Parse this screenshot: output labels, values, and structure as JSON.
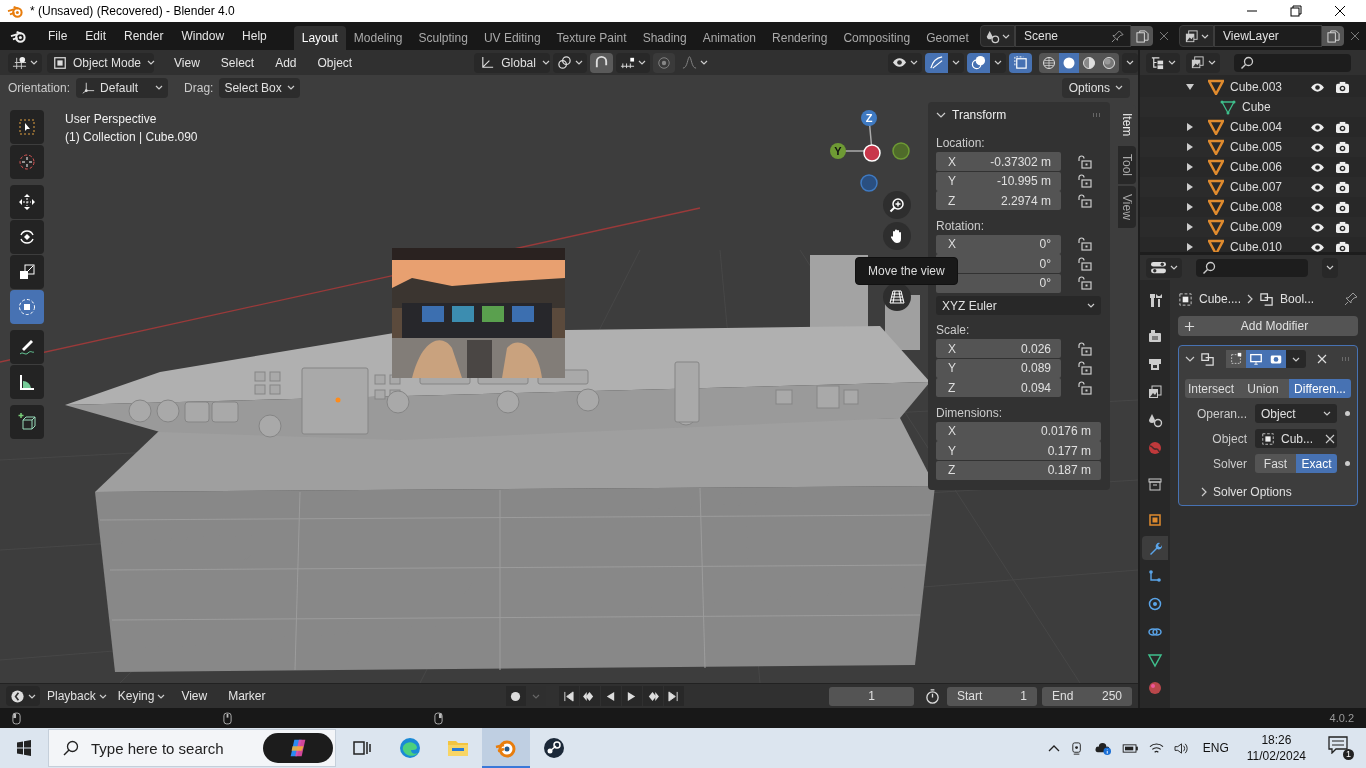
{
  "window": {
    "title": "* (Unsaved) (Recovered) - Blender 4.0"
  },
  "menu_bar": [
    "File",
    "Edit",
    "Render",
    "Window",
    "Help"
  ],
  "workspaces": [
    {
      "label": "Layout",
      "selected": true
    },
    {
      "label": "Modeling",
      "selected": false
    },
    {
      "label": "Sculpting",
      "selected": false
    },
    {
      "label": "UV Editing",
      "selected": false
    },
    {
      "label": "Texture Paint",
      "selected": false
    },
    {
      "label": "Shading",
      "selected": false
    },
    {
      "label": "Animation",
      "selected": false
    },
    {
      "label": "Rendering",
      "selected": false
    },
    {
      "label": "Compositing",
      "selected": false
    },
    {
      "label": "Geomet",
      "selected": false
    }
  ],
  "scene": {
    "name": "Scene"
  },
  "view_layer": {
    "name": "ViewLayer"
  },
  "header": {
    "mode": "Object Mode",
    "menus": [
      "View",
      "Select",
      "Add",
      "Object"
    ],
    "orientation": "Global",
    "snap": true,
    "proportional": false,
    "show_gizmo": true,
    "show_overlays": true,
    "xray": true,
    "shading": [
      {
        "kind": "wireframe",
        "selected": false
      },
      {
        "kind": "solid",
        "selected": true
      },
      {
        "kind": "material",
        "selected": false
      },
      {
        "kind": "rendered",
        "selected": false
      }
    ]
  },
  "tool_settings": {
    "orientation_label": "Orientation:",
    "orientation": "Default",
    "drag_label": "Drag:",
    "drag": "Select Box",
    "options": "Options"
  },
  "viewport": {
    "title": "User Perspective",
    "info": "(1) Collection | Cube.090",
    "gizmo_labels": [
      "Z",
      "Y"
    ],
    "tooltip": "Move the view",
    "tools": [
      {
        "kind": "select",
        "selected": false
      },
      {
        "kind": "cursor",
        "selected": false
      },
      {
        "kind": "move",
        "selected": false
      },
      {
        "kind": "rotate",
        "selected": false
      },
      {
        "kind": "scale",
        "selected": false
      },
      {
        "kind": "transform",
        "selected": true
      },
      {
        "kind": "annotate",
        "selected": false
      },
      {
        "kind": "measure",
        "selected": false
      },
      {
        "kind": "add_cube",
        "selected": false
      }
    ]
  },
  "sidebar": {
    "tabs": [
      {
        "label": "Item",
        "selected": true
      },
      {
        "label": "Tool",
        "selected": false
      },
      {
        "label": "View",
        "selected": false
      }
    ],
    "panel_title": "Transform",
    "groups": [
      {
        "label": "Location:",
        "kind": "lockable",
        "fields": [
          {
            "axis": "X",
            "value": "-0.37302 m"
          },
          {
            "axis": "Y",
            "value": "-10.995 m"
          },
          {
            "axis": "Z",
            "value": "2.2974 m"
          }
        ]
      },
      {
        "label": "Rotation:",
        "kind": "lockable",
        "mode": "XYZ Euler",
        "fields": [
          {
            "axis": "X",
            "value": "0°"
          },
          {
            "value": "0°"
          },
          {
            "value": "0°"
          }
        ]
      },
      {
        "label": "Scale:",
        "kind": "lockable",
        "fields": [
          {
            "axis": "X",
            "value": "0.026"
          },
          {
            "axis": "Y",
            "value": "0.089"
          },
          {
            "axis": "Z",
            "value": "0.094"
          }
        ]
      },
      {
        "label": "Dimensions:",
        "kind": "plain",
        "fields": [
          {
            "axis": "X",
            "value": "0.0176 m"
          },
          {
            "axis": "Y",
            "value": "0.177 m"
          },
          {
            "axis": "Z",
            "value": "0.187 m"
          }
        ]
      }
    ]
  },
  "outliner": {
    "items": [
      {
        "name": "Cube.003",
        "kind": "object",
        "expanded": true,
        "children": [
          {
            "name": "Cube",
            "kind": "mesh"
          }
        ]
      },
      {
        "name": "Cube.004",
        "kind": "object",
        "expanded": false
      },
      {
        "name": "Cube.005",
        "kind": "object",
        "expanded": false
      },
      {
        "name": "Cube.006",
        "kind": "object",
        "expanded": false
      },
      {
        "name": "Cube.007",
        "kind": "object",
        "expanded": false
      },
      {
        "name": "Cube.008",
        "kind": "object",
        "expanded": false
      },
      {
        "name": "Cube.009",
        "kind": "object",
        "expanded": false
      },
      {
        "name": "Cube.010",
        "kind": "object",
        "expanded": false
      }
    ]
  },
  "properties": {
    "tabs": [
      {
        "kind": "tool",
        "selected": false
      },
      {
        "kind": "render",
        "selected": false
      },
      {
        "kind": "output",
        "selected": false
      },
      {
        "kind": "view_layer",
        "selected": false
      },
      {
        "kind": "scene",
        "selected": false
      },
      {
        "kind": "world",
        "selected": false
      },
      {
        "kind": "collection",
        "selected": false
      },
      {
        "kind": "object",
        "selected": false
      },
      {
        "kind": "modifiers",
        "selected": true
      },
      {
        "kind": "particles",
        "selected": false
      },
      {
        "kind": "physics",
        "selected": false
      },
      {
        "kind": "constraints",
        "selected": false
      },
      {
        "kind": "data",
        "selected": false
      },
      {
        "kind": "material",
        "selected": false
      }
    ],
    "breadcrumb": [
      "Cube....",
      "Bool..."
    ],
    "add_modifier": "Add Modifier",
    "modifier": {
      "toggles": [
        {
          "kind": "editmode",
          "on": false
        },
        {
          "kind": "viewport",
          "on": true
        },
        {
          "kind": "render",
          "on": true
        }
      ],
      "operations": [
        {
          "label": "Intersect",
          "selected": false
        },
        {
          "label": "Union",
          "selected": false
        },
        {
          "label": "Differen...",
          "selected": true
        }
      ],
      "operand_label": "Operan...",
      "operand": "Object",
      "object_label": "Object",
      "object": "Cub...",
      "solver_label": "Solver",
      "solvers": [
        {
          "label": "Fast",
          "selected": false
        },
        {
          "label": "Exact",
          "selected": true
        }
      ],
      "solver_options": "Solver Options"
    }
  },
  "timeline": {
    "menus": [
      {
        "label": "Playback",
        "dropdown": true
      },
      {
        "label": "Keying",
        "dropdown": true
      },
      {
        "label": "View",
        "dropdown": false
      },
      {
        "label": "Marker",
        "dropdown": false
      }
    ],
    "current_frame": "1",
    "start_label": "Start",
    "start": "1",
    "end_label": "End",
    "end": "250"
  },
  "status_bar": {
    "version": "4.0.2"
  },
  "taskbar": {
    "search_placeholder": "Type here to search",
    "apps": [
      {
        "kind": "taskview",
        "selected": false
      },
      {
        "kind": "edge",
        "selected": false
      },
      {
        "kind": "explorer",
        "selected": false
      },
      {
        "kind": "blender",
        "selected": true
      },
      {
        "kind": "steam",
        "selected": false
      }
    ],
    "language": "ENG",
    "time": "18:26",
    "date": "11/02/2024",
    "notifications": "1"
  }
}
